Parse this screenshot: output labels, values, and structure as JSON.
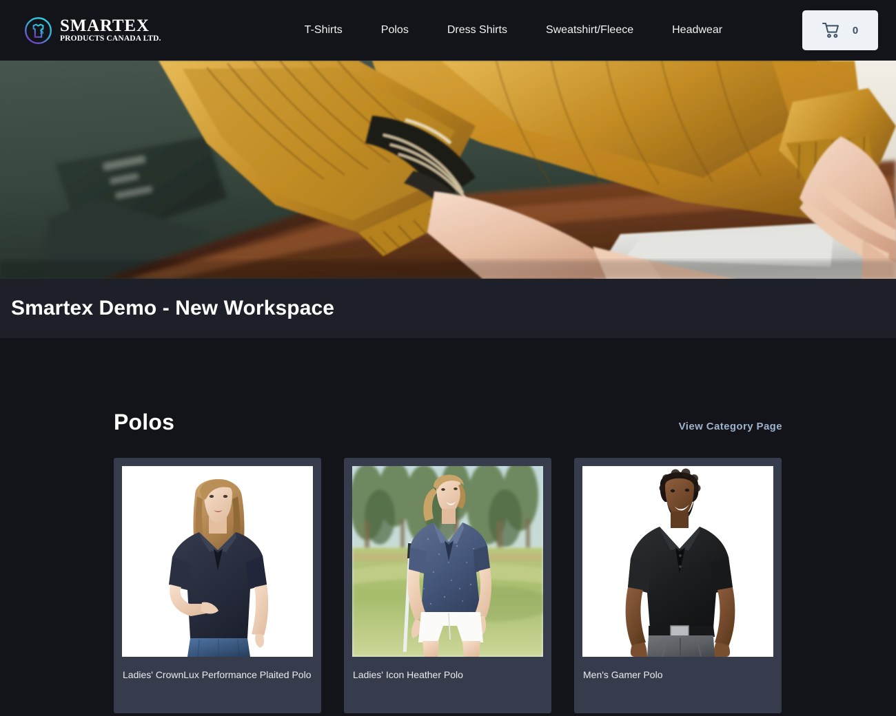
{
  "header": {
    "brand": {
      "name": "SMARTEX",
      "tagline": "PRODUCTS CANADA LTD.",
      "logo_icon": "smartex-circle-tshirt-logo",
      "gradient_from": "#22d3ee",
      "gradient_to": "#7c3aed"
    },
    "nav": [
      {
        "label": "T-Shirts"
      },
      {
        "label": "Polos"
      },
      {
        "label": "Dress Shirts"
      },
      {
        "label": "Sweatshirt/Fleece"
      },
      {
        "label": "Headwear"
      }
    ],
    "cart": {
      "icon": "shopping-cart-icon",
      "count": "0",
      "background": "#eef1f6",
      "icon_color": "#3d4f63"
    },
    "background": "#121419"
  },
  "hero": {
    "alt": "Woman in mustard knit sweater typing on a laptop at a wooden desk",
    "background": "#2c3a33"
  },
  "title_band": {
    "title": "Smartex Demo - New Workspace",
    "background": "#1e2029"
  },
  "section": {
    "title": "Polos",
    "link_label": "View Category Page",
    "link_color": "#9fb3cc"
  },
  "products": [
    {
      "name": "Ladies' CrownLux Performance Plaited Polo",
      "image_alt": "Woman wearing navy polo shirt with blue jeans on white background",
      "shirt_color": "#272b3a",
      "bg": "#ffffff"
    },
    {
      "name": "Ladies' Icon Heather Polo",
      "image_alt": "Woman in heather navy polo and white shorts on a golf course",
      "shirt_color": "#41516d",
      "bg": "#cfe3ef"
    },
    {
      "name": "Men's Gamer Polo",
      "image_alt": "Man wearing black polo shirt with grey trousers on white background",
      "shirt_color": "#17181a",
      "bg": "#ffffff"
    }
  ],
  "theme": {
    "page_background": "#121419",
    "card_background": "#373c4c",
    "text_primary": "#ffffff",
    "text_secondary": "#e9ebef"
  }
}
